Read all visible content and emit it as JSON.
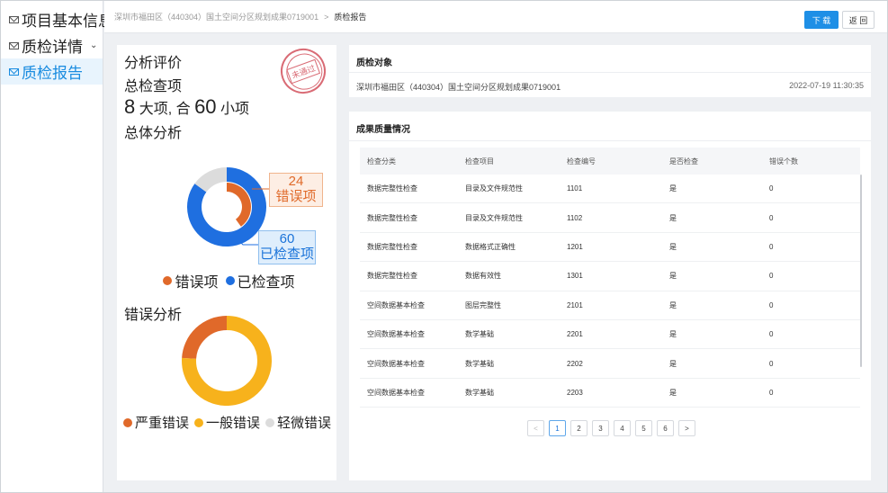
{
  "sidebar": {
    "items": [
      {
        "label": "项目基本信息"
      },
      {
        "label": "质检详情"
      },
      {
        "label": "质检报告"
      }
    ]
  },
  "header": {
    "breadcrumb": [
      "深圳市福田区（440304）国土空间分区规划成果0719001",
      "质检报告"
    ],
    "separator": ">",
    "download_label": "下 载",
    "back_label": "返 回"
  },
  "analysis": {
    "title": "分析评价",
    "stamp_text": "未通过",
    "total_title": "总检查项",
    "big_count": "8",
    "big_unit": "大项, 合",
    "small_count": "60",
    "small_unit": "小项",
    "overall_title": "总体分析",
    "error_title": "错误分析"
  },
  "chart_data": [
    {
      "type": "pie",
      "categories": [
        "错误项",
        "已检查项"
      ],
      "values": [
        24,
        60
      ],
      "colors": [
        "#e0692a",
        "#1f6fe0"
      ],
      "remainder_color": "#dcdcdc",
      "legend": "bottom",
      "labels": [
        {
          "value": "24",
          "text": "错误项"
        },
        {
          "value": "60",
          "text": "已检查项"
        }
      ]
    },
    {
      "type": "pie",
      "categories": [
        "严重错误",
        "一般错误",
        "轻微错误"
      ],
      "values": [
        24,
        76,
        0
      ],
      "colors": [
        "#e0692a",
        "#f7b21c",
        "#dcdcdc"
      ],
      "legend": "bottom"
    }
  ],
  "quality_object": {
    "title": "质检对象",
    "name": "深圳市福田区（440304）国土空间分区规划成果0719001",
    "time": "2022-07-19 11:30:35"
  },
  "results": {
    "title": "成果质量情况",
    "columns": [
      "检查分类",
      "检查项目",
      "检查编号",
      "是否检查",
      "错误个数"
    ],
    "rows": [
      [
        "数据完整性检查",
        "目录及文件规范性",
        "1101",
        "是",
        "0"
      ],
      [
        "数据完整性检查",
        "目录及文件规范性",
        "1102",
        "是",
        "0"
      ],
      [
        "数据完整性检查",
        "数据格式正确性",
        "1201",
        "是",
        "0"
      ],
      [
        "数据完整性检查",
        "数据有效性",
        "1301",
        "是",
        "0"
      ],
      [
        "空间数据基本检查",
        "图层完整性",
        "2101",
        "是",
        "0"
      ],
      [
        "空间数据基本检查",
        "数学基础",
        "2201",
        "是",
        "0"
      ],
      [
        "空间数据基本检查",
        "数学基础",
        "2202",
        "是",
        "0"
      ],
      [
        "空间数据基本检查",
        "数学基础",
        "2203",
        "是",
        "0"
      ]
    ],
    "pagination": {
      "prev": "<",
      "next": ">",
      "pages": [
        "1",
        "2",
        "3",
        "4",
        "5",
        "6"
      ],
      "current": "1"
    }
  }
}
